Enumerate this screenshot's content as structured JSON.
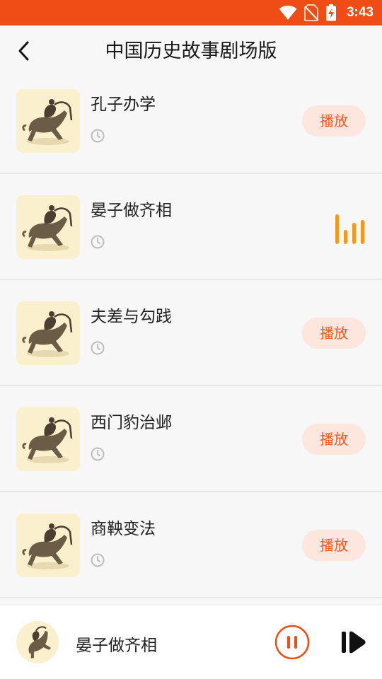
{
  "status_bar": {
    "time": "3:43",
    "icons": [
      "wifi-icon",
      "no-sim-icon",
      "battery-charging-icon"
    ]
  },
  "header": {
    "title": "中国历史故事剧场版",
    "back_icon": "chevron-left-icon"
  },
  "episodes": [
    {
      "title": "孔子办学",
      "state": "idle",
      "action_label": "播放"
    },
    {
      "title": "晏子做齐相",
      "state": "playing",
      "action_label": ""
    },
    {
      "title": "夫差与勾践",
      "state": "idle",
      "action_label": "播放"
    },
    {
      "title": "西门豹治邺",
      "state": "idle",
      "action_label": "播放"
    },
    {
      "title": "商鞅变法",
      "state": "idle",
      "action_label": "播放"
    }
  ],
  "player": {
    "title": "晏子做齐相",
    "pause_icon": "pause-icon",
    "next_icon": "skip-next-icon"
  },
  "colors": {
    "accent": "#ee4e16",
    "play_button_bg": "#fde6dd",
    "play_button_text": "#ef5a1f",
    "playing_bars": "#f39a1c",
    "thumbnail_bg": "#fbf0cd"
  }
}
